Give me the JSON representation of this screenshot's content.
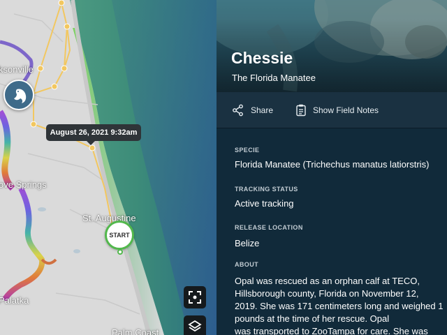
{
  "map": {
    "places": {
      "jacksonville": "ksonville",
      "green_cove_springs": "ove Springs",
      "st_augustine": "St. Augustine",
      "palatka": "Palatka",
      "palm_coast": "Palm Coast"
    },
    "tooltip": "August 26, 2021 9:32am",
    "start_label": "START",
    "track_color": "#f2c760",
    "ocean_color": "#2f8f6a",
    "buttons": {
      "recenter_icon": "focus-frame-icon",
      "layers_icon": "layers-icon"
    }
  },
  "animal": {
    "name": "Chessie",
    "species_common": "The Florida Manatee"
  },
  "actions": {
    "share_label": "Share",
    "field_notes_label": "Show Field Notes"
  },
  "details": {
    "specie_label": "SPECIE",
    "specie_value": "Florida Manatee (Trichechus manatus latiorstris)",
    "tracking_label": "TRACKING STATUS",
    "tracking_value": "Active tracking",
    "release_label": "RELEASE LOCATION",
    "release_value": "Belize",
    "about_label": "ABOUT",
    "about_lines": [
      "Opal was rescued as an orphan calf at TECO,",
      "Hillsborough county, Florida on November 12,",
      "2019. She was 171 centimeters long and weighed 1",
      "pounds at the time of her rescue. Opal",
      "was transported to ZooTampa for care. She was"
    ]
  }
}
